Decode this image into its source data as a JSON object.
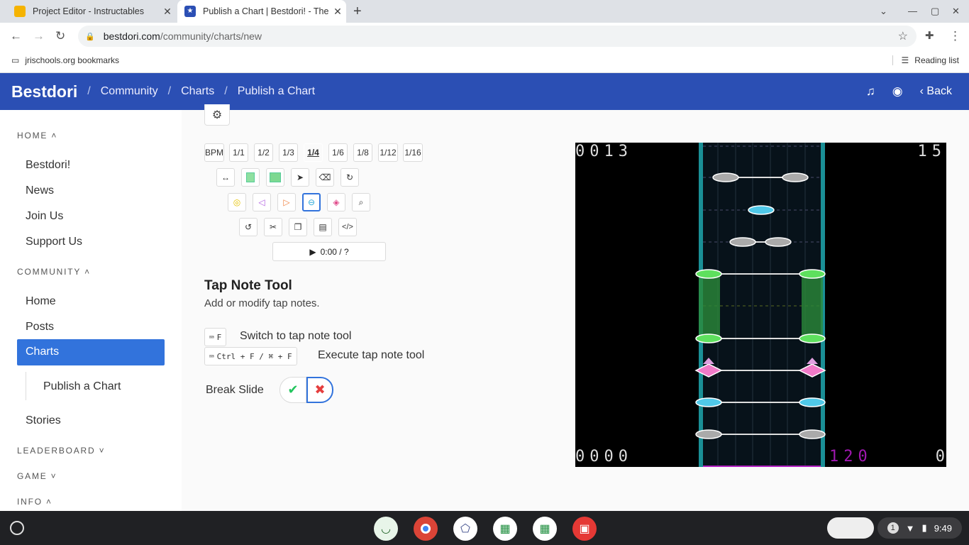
{
  "browser": {
    "tabs": [
      {
        "title": "Project Editor - Instructables",
        "close": "✕"
      },
      {
        "title": "Publish a Chart | Bestdori! - The Ultimate BanG Dream Community Database",
        "close": "✕"
      }
    ],
    "new_tab": "+",
    "url_host": "bestdori.com",
    "url_path": "/community/charts/new",
    "bookmark": "jrischools.org bookmarks",
    "reading_list": "Reading list"
  },
  "header": {
    "brand": "Bestdori",
    "crumbs": [
      "Community",
      "Charts",
      "Publish a Chart"
    ],
    "sep": "/",
    "back": "Back",
    "accent": "#2b4fb4"
  },
  "sidebar": {
    "sections": {
      "home": "HOME",
      "community": "COMMUNITY",
      "leaderboard": "LEADERBOARD",
      "game": "GAME",
      "info": "INFO"
    },
    "home_items": [
      "Bestdori!",
      "News",
      "Join Us",
      "Support Us"
    ],
    "community_items": [
      "Home",
      "Posts",
      "Charts",
      "Stories"
    ],
    "sub_item": "Publish a Chart",
    "active_color": "#3273dc"
  },
  "editor": {
    "divisions": [
      "BPM",
      "1/1",
      "1/2",
      "1/3",
      "1/4",
      "1/6",
      "1/8",
      "1/12",
      "1/16"
    ],
    "selected_division": "1/4",
    "play_time": "0:00 / ?",
    "tool_title": "Tap Note Tool",
    "tool_desc": "Add or modify tap notes.",
    "shortcut1_key": "F",
    "shortcut1_label": "Switch to tap note tool",
    "shortcut2_key": "Ctrl + F / ⌘ + F",
    "shortcut2_label": "Execute tap note tool",
    "break_slide": "Break Slide",
    "check": "✔",
    "cross": "✖"
  },
  "preview": {
    "top_left": "0013",
    "top_right": "15",
    "bottom_left": "0000",
    "bottom_mid": "120",
    "bottom_right": "0"
  },
  "shelf": {
    "notif_count": "1",
    "time": "9:49"
  }
}
